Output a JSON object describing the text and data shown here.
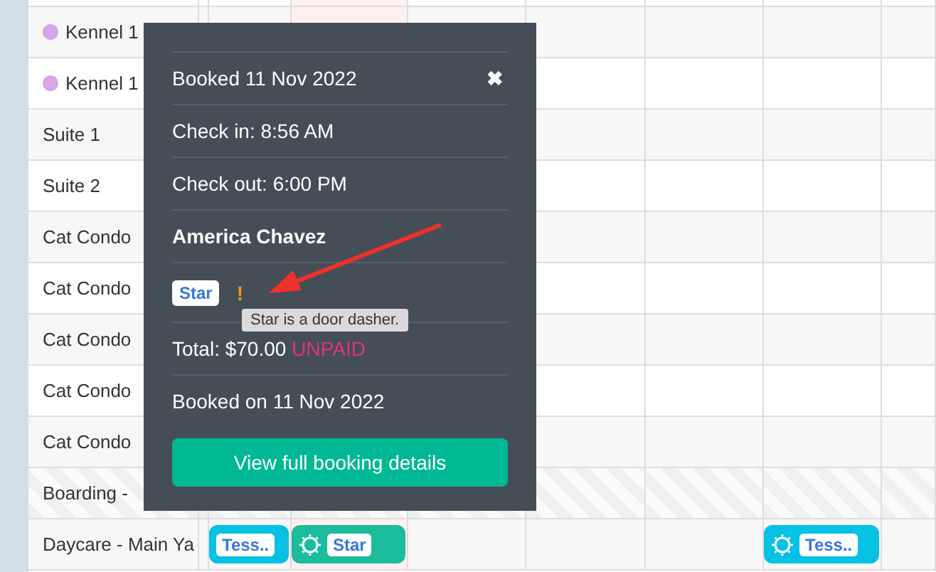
{
  "date_columns": [
    {
      "today": false
    },
    {
      "today": true
    },
    {
      "today": false
    },
    {
      "today": false
    },
    {
      "today": false
    },
    {
      "today": false
    },
    {
      "today": false
    }
  ],
  "rows": [
    {
      "name": "Kennel 1",
      "color": "#d7a6e6"
    },
    {
      "name": "Kennel 1",
      "color": "#d7a6e6"
    },
    {
      "name": "Suite 1"
    },
    {
      "name": "Suite 2"
    },
    {
      "name": "Cat Condo"
    },
    {
      "name": "Cat Condo"
    },
    {
      "name": "Cat Condo"
    },
    {
      "name": "Cat Condo"
    },
    {
      "name": "Cat Condo"
    },
    {
      "name": "Boarding -",
      "unavailable": true
    },
    {
      "name": "Daycare - Main Ya",
      "cells": [
        {
          "kind": "booking",
          "label": "Tess..",
          "color": "#05c1e4",
          "icon": false
        },
        {
          "kind": "booking",
          "label": "Star",
          "color": "#1abc9c",
          "icon": true
        },
        {
          "kind": "empty"
        },
        {
          "kind": "empty"
        },
        {
          "kind": "empty"
        },
        {
          "kind": "booking",
          "label": "Tess..",
          "color": "#05c1e4",
          "icon": true
        },
        {
          "kind": "empty"
        }
      ]
    }
  ],
  "popup": {
    "booked": "Booked 11 Nov 2022",
    "close": "✖",
    "check_in": "Check in: 8:56 AM",
    "check_out": "Check out: 6:00 PM",
    "customer": "America Chavez",
    "pet_tag": "Star",
    "alert": "!",
    "total": "Total: $70.00",
    "payment_status": "UNPAID",
    "booked_on": "Booked on 11 Nov 2022",
    "button": "View full booking details"
  },
  "tooltip": "Star is a door dasher."
}
